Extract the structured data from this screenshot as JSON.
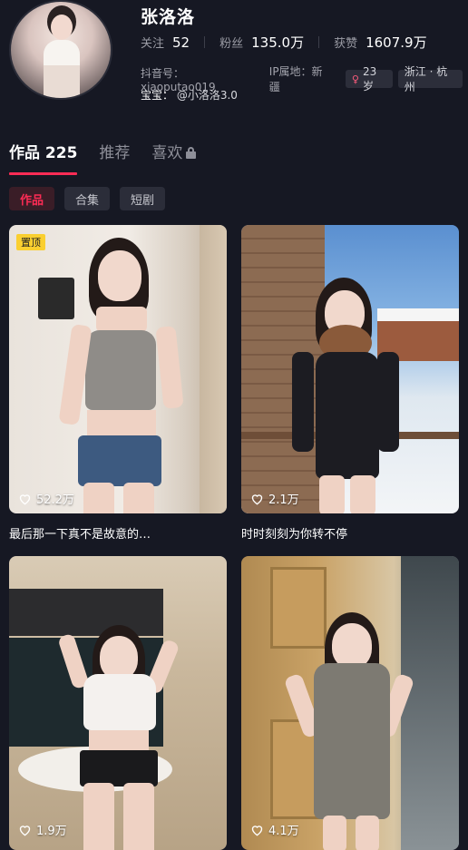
{
  "profile": {
    "name": "张洛洛",
    "stats": [
      {
        "label": "关注",
        "value": "52"
      },
      {
        "label": "粉丝",
        "value": "135.0万"
      },
      {
        "label": "获赞",
        "value": "1607.9万"
      }
    ],
    "douyin_id": "抖音号：xiaoputao019",
    "ip_location": "IP属地：新疆",
    "age_tag": "23岁",
    "location_tag": "浙江 · 杭州",
    "baobao_label": "宝宝：",
    "baobao_value": "@小洛洛3.0"
  },
  "tabs": [
    {
      "label": "作品 225",
      "active": true
    },
    {
      "label": "推荐",
      "active": false
    },
    {
      "label": "喜欢",
      "active": false,
      "locked": true
    }
  ],
  "subtabs": [
    {
      "label": "作品",
      "active": true
    },
    {
      "label": "合集",
      "active": false
    },
    {
      "label": "短剧",
      "active": false
    }
  ],
  "videos": [
    {
      "pinned_label": "置顶",
      "likes": "52.2万",
      "caption": "最后那一下真不是故意的…"
    },
    {
      "likes": "2.1万",
      "caption": "时时刻刻为你转不停"
    },
    {
      "likes": "1.9万",
      "caption": ""
    },
    {
      "likes": "4.1万",
      "caption": ""
    }
  ],
  "colors": {
    "background": "#161823",
    "accent": "#fe2c55",
    "pin_badge": "#facf30"
  }
}
